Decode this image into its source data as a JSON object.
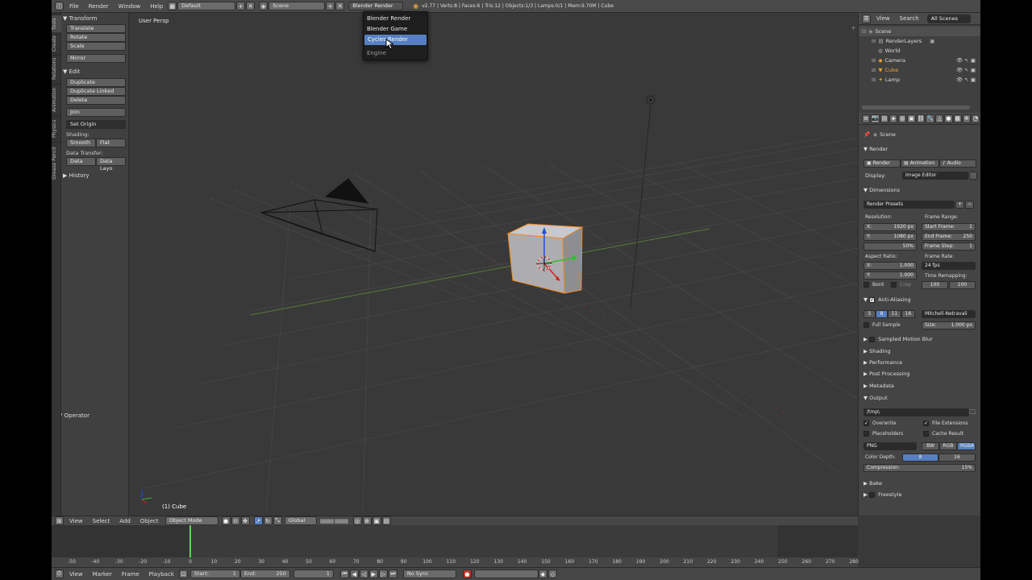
{
  "topbar": {
    "menus": [
      "File",
      "Render",
      "Window",
      "Help"
    ],
    "layout": "Default",
    "scene": "Scene",
    "engine": "Blender Render",
    "stats": "v2.77 | Verts:8 | Faces:6 | Tris:12 | Objects:1/3 | Lamps:0/1 | Mem:9.70M | Cube"
  },
  "engine_menu": {
    "items": [
      "Blender Render",
      "Blender Game",
      "Cycles Render"
    ],
    "title": "Engine"
  },
  "toolshelf": {
    "tabs": [
      "Tools",
      "Create",
      "Relations",
      "Animation",
      "Physics",
      "Grease Pencil"
    ],
    "transform_header": "Transform",
    "transform_buttons": [
      "Translate",
      "Rotate",
      "Scale"
    ],
    "mirror": "Mirror",
    "edit_header": "Edit",
    "edit_buttons": [
      "Duplicate",
      "Duplicate Linked",
      "Delete"
    ],
    "join": "Join",
    "set_origin": "Set Origin",
    "shading_label": "Shading:",
    "smooth": "Smooth",
    "flat": "Flat",
    "data_transfer_label": "Data Transfer:",
    "data": "Data",
    "data_layo": "Data Layo",
    "history_header": "History",
    "operator_header": "Operator"
  },
  "viewport": {
    "label": "User Persp",
    "object_label": "(1) Cube"
  },
  "outliner": {
    "menus": [
      "View",
      "Search"
    ],
    "scope": "All Scenes",
    "items": [
      "Scene",
      "RenderLayers",
      "World",
      "Camera",
      "Cube",
      "Lamp"
    ]
  },
  "properties": {
    "context": "Scene",
    "render_header": "Render",
    "render_btn": "Render",
    "animation_btn": "Animation",
    "audio_btn": "Audio",
    "display_label": "Display:",
    "display_value": "Image Editor",
    "dimensions_header": "Dimensions",
    "render_presets": "Render Presets",
    "resolution_label": "Resolution:",
    "res_x": "X:",
    "res_x_val": "1920 px",
    "res_y": "Y:",
    "res_y_val": "1080 px",
    "res_pct": "50%",
    "frame_range_label": "Frame Range:",
    "start_frame": "Start Frame:",
    "start_frame_val": "1",
    "end_frame": "End Frame:",
    "end_frame_val": "250",
    "frame_step": "Frame Step:",
    "frame_step_val": "1",
    "aspect_label": "Aspect Ratio:",
    "asp_x": "X:",
    "asp_x_val": "1.000",
    "asp_y": "Y:",
    "asp_y_val": "1.000",
    "frame_rate_label": "Frame Rate:",
    "frame_rate_val": "24 fps",
    "time_remap_label": "Time Remapping:",
    "old": "100",
    "new": "100",
    "bord": "Bord",
    "crop": "Crop",
    "aa_header": "Anti-Aliasing",
    "aa_samples": [
      "5",
      "8",
      "11",
      "16"
    ],
    "aa_filter": "Mitchell-Netravali",
    "full_sample": "Full Sample",
    "size_label": "Size:",
    "size_val": "1.000 px",
    "smb_header": "Sampled Motion Blur",
    "shading_header": "Shading",
    "performance_header": "Performance",
    "post_header": "Post Processing",
    "metadata_header": "Metadata",
    "output_header": "Output",
    "output_path": "/tmp\\",
    "overwrite": "Overwrite",
    "file_ext": "File Extensions",
    "placeholders": "Placeholders",
    "cache_result": "Cache Result",
    "format": "PNG",
    "bw": "BW",
    "rgb": "RGB",
    "rgba": "RGBA",
    "color_depth_label": "Color Depth:",
    "depth_8": "8",
    "depth_16": "16",
    "compression_label": "Compression:",
    "compression_val": "15%",
    "bake_header": "Bake",
    "freestyle_header": "Freestyle"
  },
  "viewport_header": {
    "menus": [
      "View",
      "Select",
      "Add",
      "Object"
    ],
    "mode": "Object Mode",
    "orientation": "Global"
  },
  "timeline": {
    "ticks": [
      "-50",
      "-40",
      "-30",
      "-20",
      "-10",
      "0",
      "10",
      "20",
      "30",
      "40",
      "50",
      "60",
      "70",
      "80",
      "90",
      "100",
      "110",
      "120",
      "130",
      "140",
      "150",
      "160",
      "170",
      "180",
      "190",
      "200",
      "210",
      "220",
      "230",
      "240",
      "250",
      "260",
      "270",
      "280"
    ],
    "menus": [
      "View",
      "Marker",
      "Frame",
      "Playback"
    ],
    "start_label": "Start:",
    "start_val": "1",
    "end_label": "End:",
    "end_val": "250",
    "current": "1",
    "sync": "No Sync"
  }
}
